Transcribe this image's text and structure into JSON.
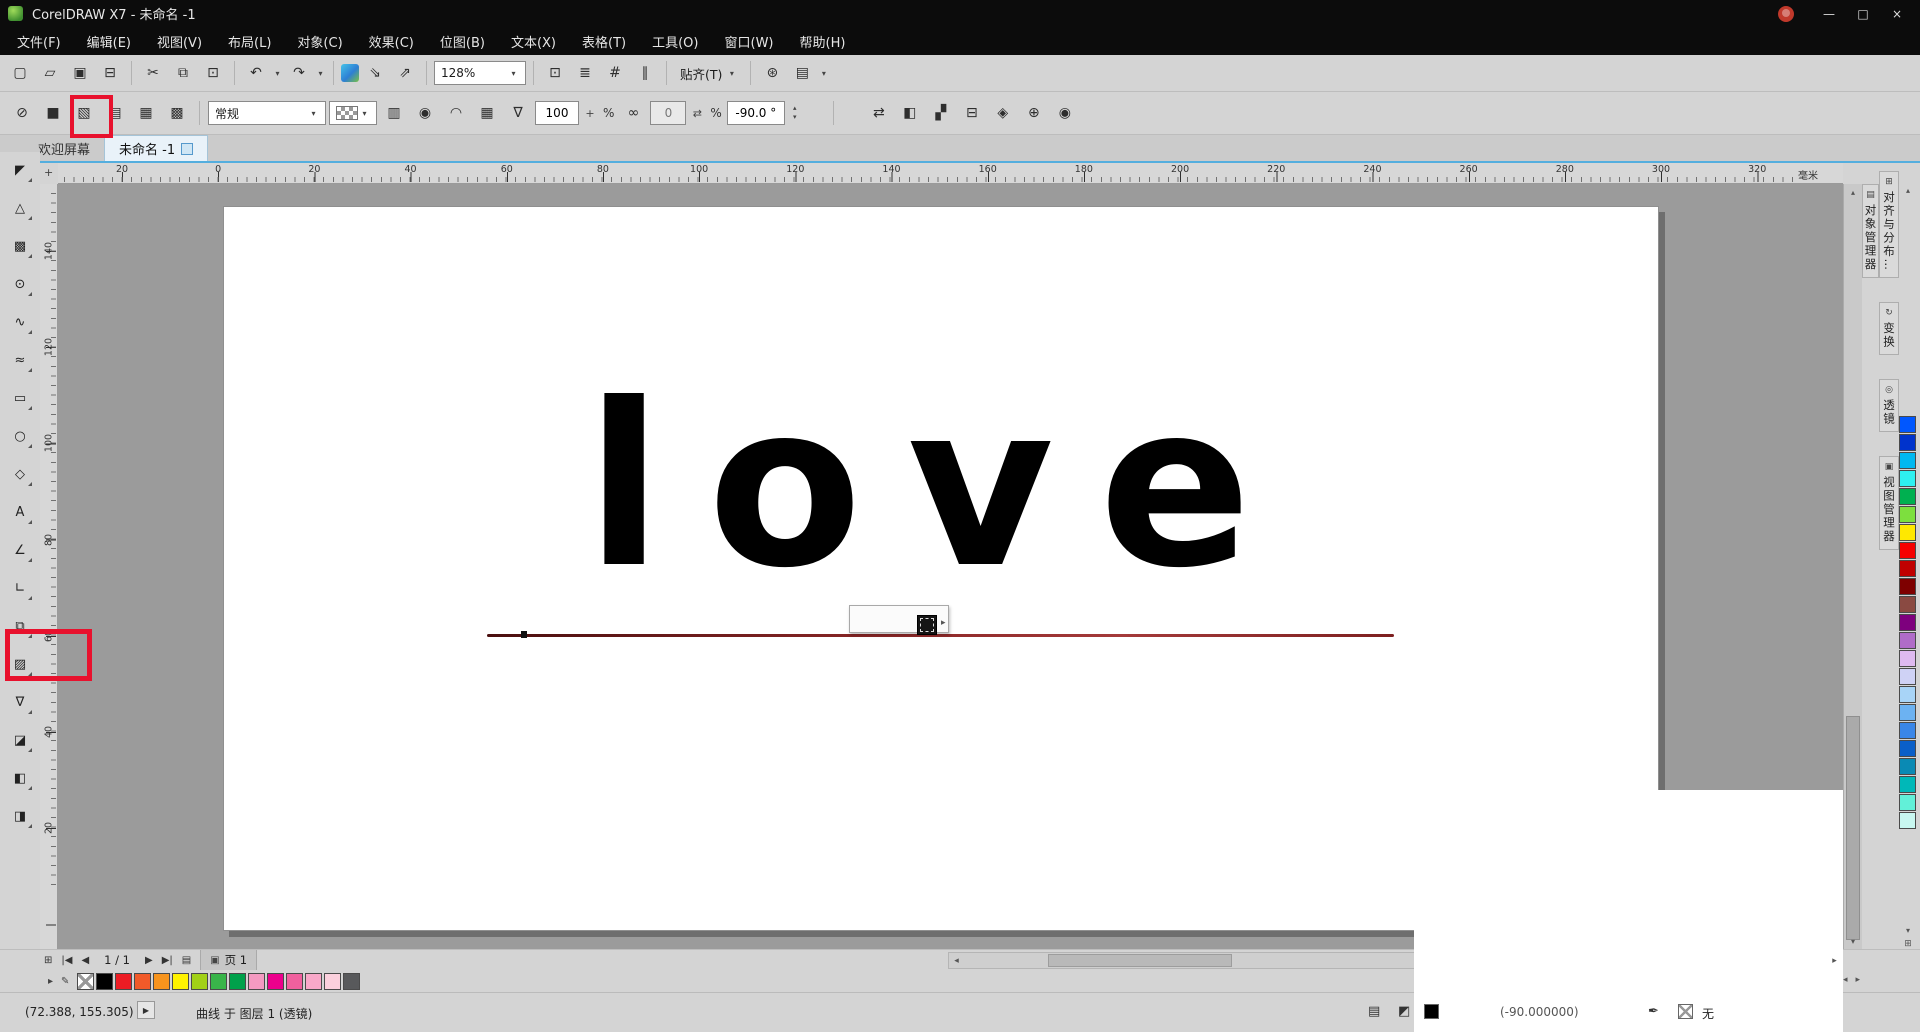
{
  "ui": {
    "caret_down": "▾",
    "caret_up": "▴",
    "arrow_right": "▸",
    "arrow_left": "◂"
  },
  "titlebar": {
    "title": "CorelDRAW X7 - 未命名 -1",
    "minimize_glyph": "—",
    "maximize_glyph": "□",
    "close_glyph": "×"
  },
  "menubar": {
    "items": [
      "文件(F)",
      "编辑(E)",
      "视图(V)",
      "布局(L)",
      "对象(C)",
      "效果(C)",
      "位图(B)",
      "文本(X)",
      "表格(T)",
      "工具(O)",
      "窗口(W)",
      "帮助(H)"
    ]
  },
  "toolbar_standard": {
    "buttons_a": [
      {
        "name": "new-document-icon",
        "glyph": "▢"
      },
      {
        "name": "open-icon",
        "glyph": "▱"
      },
      {
        "name": "save-icon",
        "glyph": "▣"
      },
      {
        "name": "print-icon",
        "glyph": "⊟"
      }
    ],
    "buttons_b": [
      {
        "name": "cut-icon",
        "glyph": "✂"
      },
      {
        "name": "copy-icon",
        "glyph": "⧉"
      },
      {
        "name": "paste-icon",
        "glyph": "⊡"
      }
    ],
    "undo_glyph": "↶",
    "redo_glyph": "↷",
    "buttons_c": [
      {
        "name": "import-icon",
        "glyph": "⇘"
      },
      {
        "name": "export-icon",
        "glyph": "⇗"
      }
    ],
    "zoom_value": "128%",
    "buttons_d": [
      {
        "name": "fullscreen-preview-icon",
        "glyph": "⊡"
      },
      {
        "name": "show-rulers-icon",
        "glyph": "≣"
      },
      {
        "name": "show-grid-icon",
        "glyph": "#"
      },
      {
        "name": "show-guidelines-icon",
        "glyph": "∥"
      }
    ],
    "snap_label": "贴齐(T)",
    "buttons_e": [
      {
        "name": "options-icon",
        "glyph": "⊛"
      },
      {
        "name": "application-launcher-icon",
        "glyph": "▤"
      }
    ]
  },
  "propbar": {
    "type_buttons": [
      {
        "name": "no-transparency-icon",
        "glyph": "⊘"
      },
      {
        "name": "uniform-transparency-icon",
        "glyph": "■"
      },
      {
        "name": "fountain-transparency-icon",
        "glyph": "▧"
      },
      {
        "name": "vector-pattern-transparency-icon",
        "glyph": "▤"
      },
      {
        "name": "bitmap-pattern-transparency-icon",
        "glyph": "▦"
      },
      {
        "name": "texture-transparency-icon",
        "glyph": "▩"
      }
    ],
    "merge_mode_value": "常规",
    "fountain_subtypes": [
      {
        "name": "linear-fountain-icon",
        "glyph": "▥"
      },
      {
        "name": "elliptical-fountain-icon",
        "glyph": "◉"
      },
      {
        "name": "conical-fountain-icon",
        "glyph": "◠"
      },
      {
        "name": "rectangular-fountain-icon",
        "glyph": "▦"
      }
    ],
    "picker_glyph": "∇",
    "opacity_value": "100",
    "opacity_plus": "+",
    "percent": "%",
    "link_glyph": "∞",
    "edge_value": "0",
    "swap_glyph": "⇄",
    "rotation_value": "-90.0 °",
    "trailing_buttons": [
      {
        "name": "copy-transparency-icon",
        "glyph": "⇄"
      },
      {
        "name": "freeze-transparency-icon",
        "glyph": "◧"
      },
      {
        "name": "edit-transparency-icon",
        "glyph": "▞"
      },
      {
        "name": "wrap-icon",
        "glyph": "⊟"
      },
      {
        "name": "mirror-icon",
        "glyph": "◈"
      },
      {
        "name": "target-icon",
        "glyph": "⊕"
      },
      {
        "name": "info-icon",
        "glyph": "◉"
      }
    ]
  },
  "tabsrow": {
    "tabs": [
      {
        "label": "欢迎屏幕"
      },
      {
        "label": "未命名 -1"
      }
    ]
  },
  "rulers": {
    "origin_glyph": "+",
    "horizontal_labels": [
      "20",
      "0",
      "20",
      "40",
      "60",
      "80",
      "100",
      "120",
      "140",
      "160",
      "180",
      "200",
      "220",
      "240",
      "260",
      "280",
      "300",
      "320"
    ],
    "units": "毫米",
    "vertical_labels": [
      "140",
      "120",
      "100",
      "80",
      "60",
      "40",
      "20"
    ]
  },
  "toolbox": {
    "tools": [
      {
        "name": "pick-tool",
        "glyph": "◤"
      },
      {
        "name": "shape-tool",
        "glyph": "△"
      },
      {
        "name": "crop-tool",
        "glyph": "▩"
      },
      {
        "name": "zoom-tool",
        "glyph": "⊙"
      },
      {
        "name": "freehand-tool",
        "glyph": "∿"
      },
      {
        "name": "artistic-media-tool",
        "glyph": "≈"
      },
      {
        "name": "rectangle-tool",
        "glyph": "▭"
      },
      {
        "name": "ellipse-tool",
        "glyph": "○"
      },
      {
        "name": "polygon-tool",
        "glyph": "◇"
      },
      {
        "name": "text-tool",
        "glyph": "A"
      },
      {
        "name": "dimension-tool",
        "glyph": "∠"
      },
      {
        "name": "connector-tool",
        "glyph": "∟"
      },
      {
        "name": "drop-shadow-tool",
        "glyph": "⧉"
      },
      {
        "name": "transparency-tool",
        "glyph": "▨"
      },
      {
        "name": "color-eyedropper-tool",
        "glyph": "∇"
      },
      {
        "name": "outline-pen-tool",
        "glyph": "◪"
      },
      {
        "name": "fill-tool",
        "glyph": "◧"
      },
      {
        "name": "interactive-fill-tool",
        "glyph": "◨"
      }
    ]
  },
  "canvas": {
    "artwork_text": "love"
  },
  "dockers": {
    "group_a": [
      {
        "name": "docker-tab-object-manager",
        "icon": "▤",
        "label": "对象管理器"
      }
    ],
    "group_b": [
      {
        "name": "docker-tab-align-distribute",
        "icon": "⊞",
        "label": "对齐与分布…"
      },
      {
        "name": "docker-tab-transform",
        "icon": "↻",
        "label": "变换"
      },
      {
        "name": "docker-tab-lens",
        "icon": "◎",
        "label": "透镜"
      },
      {
        "name": "docker-tab-view-manager",
        "icon": "▣",
        "label": "视图管理器"
      }
    ]
  },
  "palette_right": {
    "flyout_glyph": "⊞",
    "colors": [
      "#0057ff",
      "#0033cc",
      "#00b8f0",
      "#2ef0f0",
      "#00b050",
      "#7ddf3e",
      "#ffe800",
      "#f50000",
      "#c00000",
      "#7e0000",
      "#8a4a42",
      "#7e007e",
      "#b06cc8",
      "#debaf0",
      "#cfd2f5",
      "#a8d4f7",
      "#6cb2f2",
      "#3a86e8",
      "#0a5fc8",
      "#0a8ab4",
      "#00b8b8",
      "#62f0d8",
      "#c8f7f0"
    ]
  },
  "palette_bottom": {
    "edit_glyph": "✎",
    "colors": [
      "#000000",
      "#ed1c24",
      "#f15a29",
      "#f7941d",
      "#fff200",
      "#a2d117",
      "#39b54a",
      "#00a14b",
      "#f49ac1",
      "#ec008c",
      "#f0609e",
      "#f9a8c9",
      "#fbd0dd",
      "#58595b"
    ]
  },
  "page_nav": {
    "add_page_glyph": "⊞",
    "first_glyph": "|◀",
    "prev_glyph": "◀",
    "page_info": "1 / 1",
    "next_glyph": "▶",
    "last_glyph": "▶|",
    "page_list_glyph": "▤",
    "page_tab_icon_glyph": "▣",
    "page_tab_label": "页 1"
  },
  "statusbar": {
    "coordinates": "(72.388, 155.305)",
    "play_glyph": "▶",
    "object_info": "曲线 于 图层 1 (透镜)",
    "doc_icon_glyph": "▤",
    "proof_icon_glyph": "◩",
    "fill_color": "#000000",
    "fill_text": "(-90.000000)",
    "outline_pen_glyph": "✒",
    "outline_label": "无"
  }
}
